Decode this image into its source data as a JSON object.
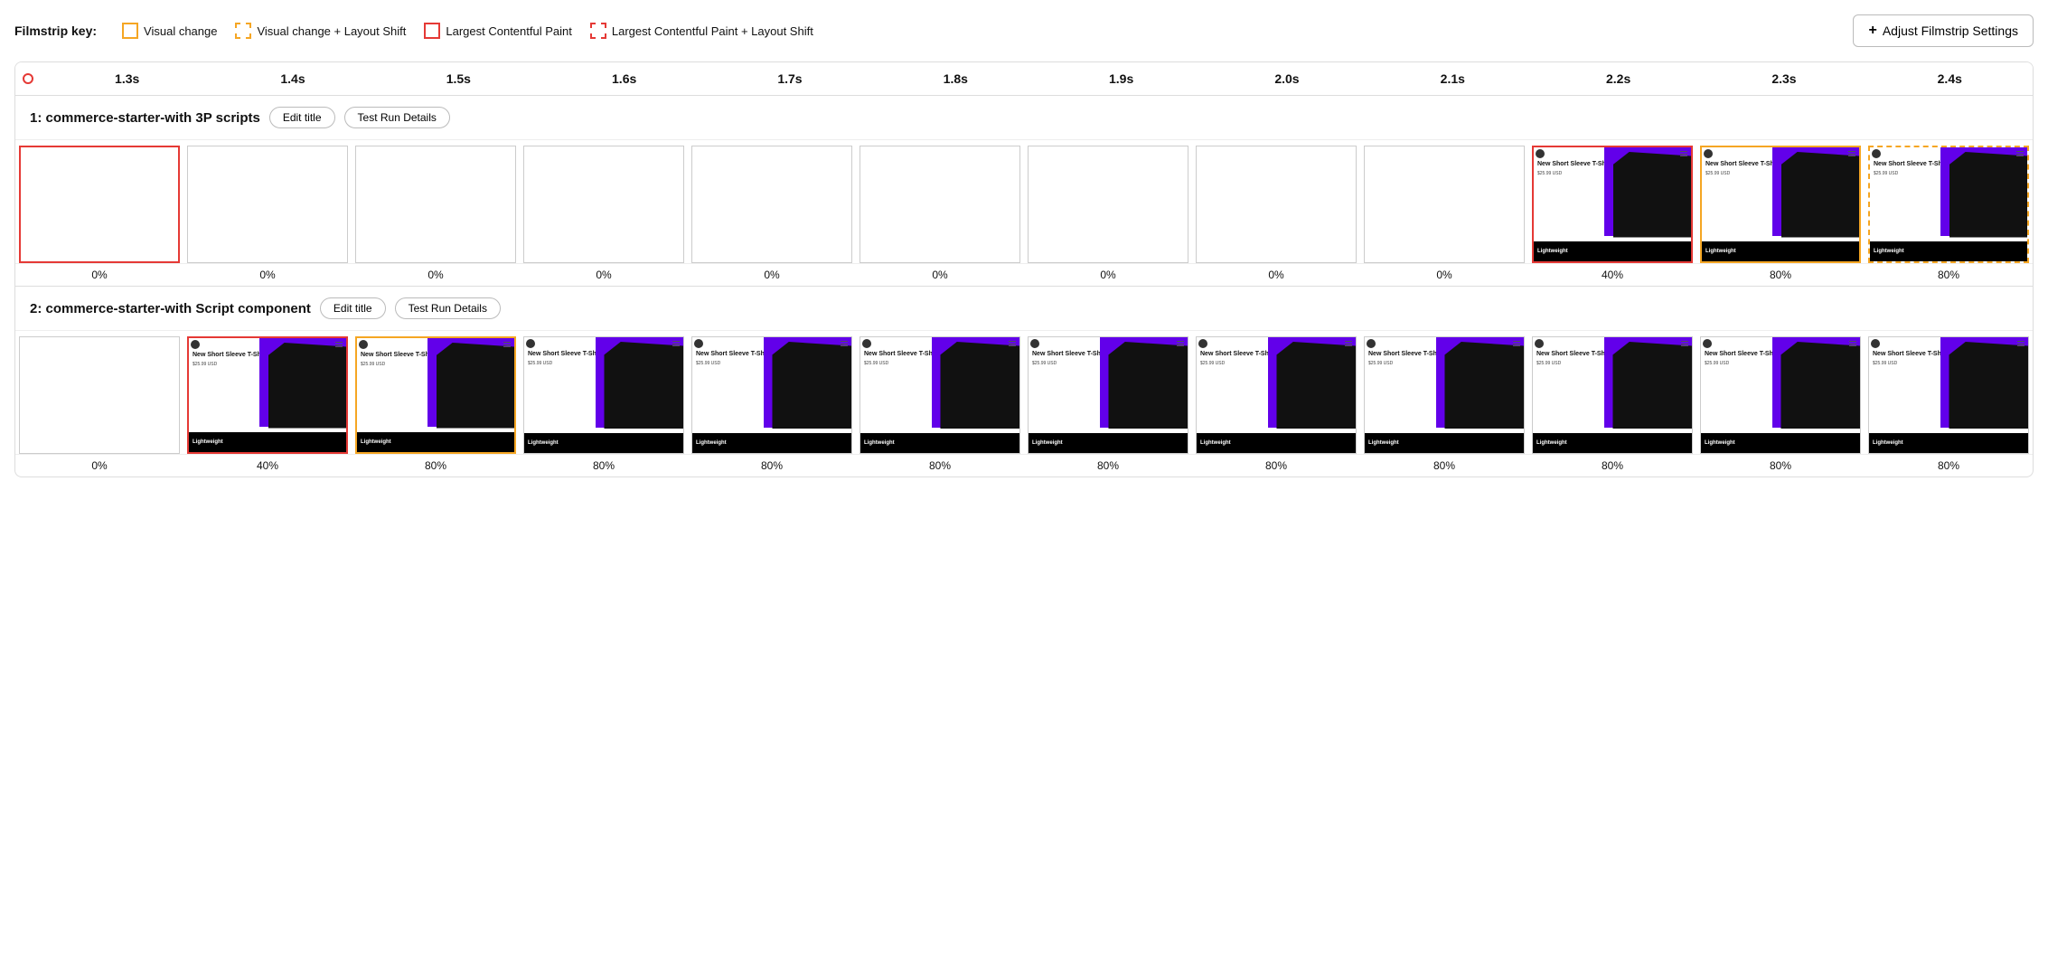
{
  "legend": {
    "label": "Filmstrip key:",
    "items": [
      {
        "id": "visual-change",
        "label": "Visual change",
        "swatchClass": "swatch-yellow"
      },
      {
        "id": "visual-change-layout-shift",
        "label": "Visual change + Layout Shift",
        "swatchClass": "swatch-yellow-dashed"
      },
      {
        "id": "lcp",
        "label": "Largest Contentful Paint",
        "swatchClass": "swatch-red"
      },
      {
        "id": "lcp-layout-shift",
        "label": "Largest Contentful Paint + Layout Shift",
        "swatchClass": "swatch-red-dashed"
      }
    ],
    "adjustBtn": "Adjust Filmstrip Settings"
  },
  "timeline": {
    "ticks": [
      "1.3s",
      "1.4s",
      "1.5s",
      "1.6s",
      "1.7s",
      "1.8s",
      "1.9s",
      "2.0s",
      "2.1s",
      "2.2s",
      "2.3s",
      "2.4s"
    ]
  },
  "sections": [
    {
      "id": "section-1",
      "title": "1: commerce-starter-with 3P scripts",
      "editBtn": "Edit title",
      "detailsBtn": "Test Run Details",
      "frames": [
        {
          "border": "red",
          "hasProduct": false,
          "pct": "0%"
        },
        {
          "border": "normal",
          "hasProduct": false,
          "pct": "0%"
        },
        {
          "border": "normal",
          "hasProduct": false,
          "pct": "0%"
        },
        {
          "border": "normal",
          "hasProduct": false,
          "pct": "0%"
        },
        {
          "border": "normal",
          "hasProduct": false,
          "pct": "0%"
        },
        {
          "border": "normal",
          "hasProduct": false,
          "pct": "0%"
        },
        {
          "border": "normal",
          "hasProduct": false,
          "pct": "0%"
        },
        {
          "border": "normal",
          "hasProduct": false,
          "pct": "0%"
        },
        {
          "border": "normal",
          "hasProduct": false,
          "pct": "0%"
        },
        {
          "border": "red",
          "hasProduct": true,
          "pct": "40%"
        },
        {
          "border": "yellow",
          "hasProduct": true,
          "pct": "80%"
        },
        {
          "border": "yellow-dashed",
          "hasProduct": true,
          "pct": "80%"
        }
      ]
    },
    {
      "id": "section-2",
      "title": "2: commerce-starter-with Script component",
      "editBtn": "Edit title",
      "detailsBtn": "Test Run Details",
      "frames": [
        {
          "border": "normal",
          "hasProduct": false,
          "pct": "0%"
        },
        {
          "border": "red",
          "hasProduct": true,
          "pct": "40%"
        },
        {
          "border": "yellow",
          "hasProduct": true,
          "pct": "80%"
        },
        {
          "border": "normal",
          "hasProduct": true,
          "pct": "80%"
        },
        {
          "border": "normal",
          "hasProduct": true,
          "pct": "80%"
        },
        {
          "border": "normal",
          "hasProduct": true,
          "pct": "80%"
        },
        {
          "border": "normal",
          "hasProduct": true,
          "pct": "80%"
        },
        {
          "border": "normal",
          "hasProduct": true,
          "pct": "80%"
        },
        {
          "border": "normal",
          "hasProduct": true,
          "pct": "80%"
        },
        {
          "border": "normal",
          "hasProduct": true,
          "pct": "80%"
        },
        {
          "border": "normal",
          "hasProduct": true,
          "pct": "80%"
        },
        {
          "border": "normal",
          "hasProduct": true,
          "pct": "80%"
        }
      ]
    }
  ],
  "product": {
    "name": "New Short Sleeve T-Shirt",
    "price": "$25.99 USD",
    "tag": "Lightweight"
  }
}
